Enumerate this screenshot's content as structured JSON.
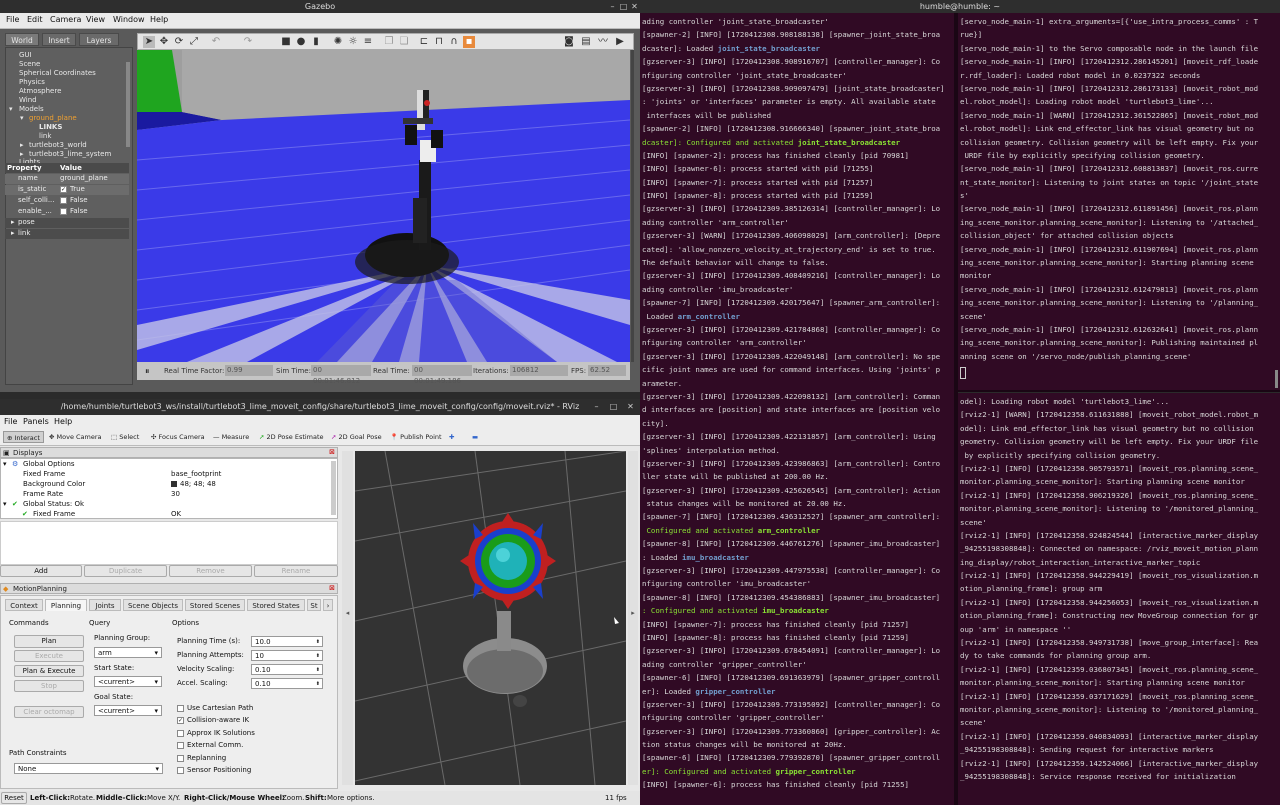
{
  "gazebo": {
    "title": "Gazebo",
    "menu": [
      "File",
      "Edit",
      "Camera",
      "View",
      "Window",
      "Help"
    ],
    "tabs": [
      "World",
      "Insert",
      "Layers"
    ],
    "tree": [
      "GUI",
      "Scene",
      "Spherical Coordinates",
      "Physics",
      "Atmosphere",
      "Wind",
      "Models",
      "ground_plane",
      "LINKS",
      "link",
      "turtlebot3_world",
      "turtlebot3_lime_system",
      "Lights"
    ],
    "prop_header": {
      "property": "Property",
      "value": "Value"
    },
    "props": [
      {
        "k": "name",
        "v": "ground_plane"
      },
      {
        "k": "is_static",
        "v": "True"
      },
      {
        "k": "self_colli...",
        "v": "False"
      },
      {
        "k": "enable_...",
        "v": "False"
      },
      {
        "k": "pose",
        "v": ""
      },
      {
        "k": "link",
        "v": ""
      }
    ],
    "status": {
      "rtf_label": "Real Time Factor:",
      "rtf": "0.99",
      "sim_label": "Sim Time:",
      "sim": "00 00:01:46.812",
      "real_label": "Real Time:",
      "real": "00 00:01:49.186",
      "iter_label": "Iterations:",
      "iter": "106812",
      "fps_label": "FPS:",
      "fps": "62.52"
    }
  },
  "rviz": {
    "title": "/home/humble/turtlebot3_ws/install/turtlebot3_lime_moveit_config/share/turtlebot3_lime_moveit_config/config/moveit.rviz* - RViz",
    "menu": [
      "File",
      "Panels",
      "Help"
    ],
    "tools": [
      "Interact",
      "Move Camera",
      "Select",
      "Focus Camera",
      "Measure",
      "2D Pose Estimate",
      "2D Goal Pose",
      "Publish Point"
    ],
    "displays_title": "Displays",
    "displays": [
      {
        "k": "Global Options",
        "v": ""
      },
      {
        "k": "Fixed Frame",
        "v": "base_footprint"
      },
      {
        "k": "Background Color",
        "v": "48; 48; 48"
      },
      {
        "k": "Frame Rate",
        "v": "30"
      },
      {
        "k": "Global Status: Ok",
        "v": ""
      },
      {
        "k": "Fixed Frame",
        "v": "OK"
      }
    ],
    "display_buttons": [
      "Add",
      "Duplicate",
      "Remove",
      "Rename"
    ],
    "mp_title": "MotionPlanning",
    "mp_tabs": [
      "Context",
      "Planning",
      "Joints",
      "Scene Objects",
      "Stored Scenes",
      "Stored States",
      "St"
    ],
    "commands_label": "Commands",
    "cmd_buttons": [
      "Plan",
      "Execute",
      "Plan & Execute",
      "Stop",
      "Clear octomap"
    ],
    "query_label": "Query",
    "planning_group_label": "Planning Group:",
    "planning_group": "arm",
    "start_state_label": "Start State:",
    "start_state": "<current>",
    "goal_state_label": "Goal State:",
    "goal_state": "<current>",
    "options_label": "Options",
    "opts": [
      {
        "k": "Planning Time (s):",
        "v": "10.0"
      },
      {
        "k": "Planning Attempts:",
        "v": "10"
      },
      {
        "k": "Velocity Scaling:",
        "v": "0.10"
      },
      {
        "k": "Accel. Scaling:",
        "v": "0.10"
      }
    ],
    "checks": [
      {
        "k": "Use Cartesian Path",
        "v": false
      },
      {
        "k": "Collision-aware IK",
        "v": true
      },
      {
        "k": "Approx IK Solutions",
        "v": false
      },
      {
        "k": "External Comm.",
        "v": false
      },
      {
        "k": "Replanning",
        "v": false
      },
      {
        "k": "Sensor Positioning",
        "v": false
      }
    ],
    "path_constraints_label": "Path Constraints",
    "path_constraints": "None",
    "reset": "Reset",
    "hint_a": "Left-Click:",
    "hint_a_t": "Rotate.",
    "hint_b": "Middle-Click:",
    "hint_b_t": "Move X/Y.",
    "hint_c": "Right-Click/Mouse Wheel:",
    "hint_c_t": "Zoom.",
    "hint_d": "Shift:",
    "hint_d_t": "More options.",
    "fps": "11 fps"
  },
  "terminal": {
    "title": "humble@humble: ~",
    "left": [
      "ading controller 'joint_state_broadcaster'",
      "[spawner-2] [INFO] [1720412308.908188138] [spawner_joint_state_broa",
      "dcaster]: Loaded |joint_state_broadcaster",
      "[gzserver-3] [INFO] [1720412308.908916707] [controller_manager]: Co",
      "nfiguring controller 'joint_state_broadcaster'",
      "[gzserver-3] [INFO] [1720412308.909097479] [joint_state_broadcaster]",
      ": 'joints' or 'interfaces' parameter is empty. All available state",
      " interfaces will be published",
      "[spawner-2] [INFO] [1720412308.916666340] [spawner_joint_state_broa",
      "dcaster]: Configured and activated |joint_state_broadcaster",
      "[INFO] [spawner-2]: process has finished cleanly [pid 70981]",
      "[INFO] [spawner-6]: process started with pid [71255]",
      "[INFO] [spawner-7]: process started with pid [71257]",
      "[INFO] [spawner-8]: process started with pid [71259]",
      "[gzserver-3] [INFO] [1720412309.385126314] [controller_manager]: Lo",
      "ading controller 'arm_controller'",
      "[gzserver-3] [WARN] [1720412309.406098029] [arm_controller]: [Depre",
      "cated]: 'allow_nonzero_velocity_at_trajectory_end' is set to true.",
      "The default behavior will change to false.",
      "[gzserver-3] [INFO] [1720412309.408409216] [controller_manager]: Lo",
      "ading controller 'imu_broadcaster'",
      "[spawner-7] [INFO] [1720412309.420175647] [spawner_arm_controller]:",
      " Loaded |arm_controller",
      "[gzserver-3] [INFO] [1720412309.421784868] [controller_manager]: Co",
      "nfiguring controller 'arm_controller'",
      "[gzserver-3] [INFO] [1720412309.422049148] [arm_controller]: No spe",
      "cific joint names are used for command interfaces. Using 'joints' p",
      "arameter.",
      "[gzserver-3] [INFO] [1720412309.422098132] [arm_controller]: Comman",
      "d interfaces are [position] and state interfaces are [position velo",
      "city].",
      "[gzserver-3] [INFO] [1720412309.422131857] [arm_controller]: Using",
      "'splines' interpolation method.",
      "[gzserver-3] [INFO] [1720412309.423986863] [arm_controller]: Contro",
      "ller state will be published at 200.00 Hz.",
      "[gzserver-3] [INFO] [1720412309.425626545] [arm_controller]: Action",
      " status changes will be monitored at 20.00 Hz.",
      "[spawner-7] [INFO] [1720412309.436312527] [spawner_arm_controller]:",
      " Configured and activated |arm_controller",
      "[spawner-8] [INFO] [1720412309.446761276] [spawner_imu_broadcaster]",
      ": Loaded |imu_broadcaster",
      "[gzserver-3] [INFO] [1720412309.447975538] [controller_manager]: Co",
      "nfiguring controller 'imu_broadcaster'",
      "[spawner-8] [INFO] [1720412309.454386883] [spawner_imu_broadcaster]",
      ": Configured and activated |imu_broadcaster",
      "[INFO] [spawner-7]: process has finished cleanly [pid 71257]",
      "[INFO] [spawner-8]: process has finished cleanly [pid 71259]",
      "[gzserver-3] [INFO] [1720412309.678454091] [controller_manager]: Lo",
      "ading controller 'gripper_controller'",
      "[spawner-6] [INFO] [1720412309.691363979] [spawner_gripper_controll",
      "er]: Loaded |gripper_controller",
      "[gzserver-3] [INFO] [1720412309.773195092] [controller_manager]: Co",
      "nfiguring controller 'gripper_controller'",
      "[gzserver-3] [INFO] [1720412309.773360860] [gripper_controller]: Ac",
      "tion status changes will be monitored at 20Hz.",
      "[spawner-6] [INFO] [1720412309.779392870] [spawner_gripper_controll",
      "er]: Configured and activated |gripper_controller",
      "[INFO] [spawner-6]: process has finished cleanly [pid 71255]"
    ],
    "right_top": [
      "[servo_node_main-1] extra_arguments=[{'use_intra_process_comms' : T",
      "rue}]",
      "[servo_node_main-1] to the Servo composable node in the launch file",
      "[servo_node_main-1] [INFO] [1720412312.286145201] [moveit_rdf_loade",
      "r.rdf_loader]: Loaded robot model in 0.0237322 seconds",
      "[servo_node_main-1] [INFO] [1720412312.286173133] [moveit_robot_mod",
      "el.robot_model]: Loading robot model 'turtlebot3_lime'...",
      "[servo_node_main-1] [WARN] [1720412312.361522865] [moveit_robot_mod",
      "el.robot_model]: Link end_effector_link has visual geometry but no",
      "collision geometry. Collision geometry will be left empty. Fix your",
      " URDF file by explicitly specifying collision geometry.",
      "[servo_node_main-1] [INFO] [1720412312.608813837] [moveit_ros.curre",
      "nt_state_monitor]: Listening to joint states on topic '/joint_state",
      "s'",
      "[servo_node_main-1] [INFO] [1720412312.611891456] [moveit_ros.plann",
      "ing_scene_monitor.planning_scene_monitor]: Listening to '/attached_",
      "collision_object' for attached collision objects",
      "[servo_node_main-1] [INFO] [1720412312.611907694] [moveit_ros.plann",
      "ing_scene_monitor.planning_scene_monitor]: Starting planning scene",
      "monitor",
      "[servo_node_main-1] [INFO] [1720412312.612479813] [moveit_ros.plann",
      "ing_scene_monitor.planning_scene_monitor]: Listening to '/planning_",
      "scene'",
      "[servo_node_main-1] [INFO] [1720412312.612632641] [moveit_ros.plann",
      "ing_scene_monitor.planning_scene_monitor]: Publishing maintained pl",
      "anning scene on '/servo_node/publish_planning_scene'"
    ],
    "right_bottom": [
      "odel]: Loading robot model 'turtlebot3_lime'...",
      "[rviz2-1] [WARN] [1720412358.611631888] [moveit_robot_model.robot_m",
      "odel]: Link end_effector_link has visual geometry but no collision",
      "geometry. Collision geometry will be left empty. Fix your URDF file",
      " by explicitly specifying collision geometry.",
      "[rviz2-1] [INFO] [1720412358.905793571] [moveit_ros.planning_scene_",
      "monitor.planning_scene_monitor]: Starting planning scene monitor",
      "[rviz2-1] [INFO] [1720412358.906219326] [moveit_ros.planning_scene_",
      "monitor.planning_scene_monitor]: Listening to '/monitored_planning_",
      "scene'",
      "[rviz2-1] [INFO] [1720412358.924824544] [interactive_marker_display",
      "_94255198308848]: Connected on namespace: /rviz_moveit_motion_plann",
      "ing_display/robot_interaction_interactive_marker_topic",
      "[rviz2-1] [INFO] [1720412358.944229419] [moveit_ros_visualization.m",
      "otion_planning_frame]: group arm",
      "[rviz2-1] [INFO] [1720412358.944256053] [moveit_ros_visualization.m",
      "otion_planning_frame]: Constructing new MoveGroup connection for gr",
      "oup 'arm' in namespace ''",
      "[rviz2-1] [INFO] [1720412358.949731738] [move_group_interface]: Rea",
      "dy to take commands for planning group arm.",
      "[rviz2-1] [INFO] [1720412359.036807345] [moveit_ros.planning_scene_",
      "monitor.planning_scene_monitor]: Starting planning scene monitor",
      "[rviz2-1] [INFO] [1720412359.037171629] [moveit_ros.planning_scene_",
      "monitor.planning_scene_monitor]: Listening to '/monitored_planning_",
      "scene'",
      "[rviz2-1] [INFO] [1720412359.040834093] [interactive_marker_display",
      "_94255198308848]: Sending request for interactive markers",
      "[rviz2-1] [INFO] [1720412359.142524066] [interactive_marker_display",
      "_94255198308848]: Service response received for initialization"
    ]
  }
}
